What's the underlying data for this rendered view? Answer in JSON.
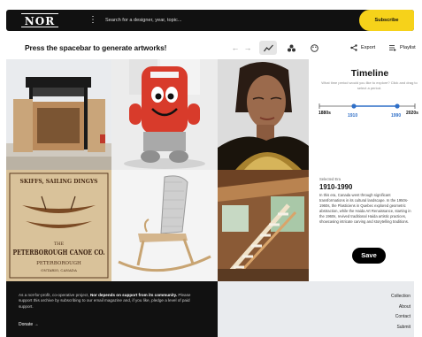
{
  "header": {
    "logo": "NOR",
    "search_placeholder": "Search for a designer, year, topic...",
    "subscribe_label": "Subscribe"
  },
  "toolbar": {
    "prompt": "Press the spacebar to generate artworks!",
    "export_label": "Export",
    "playlist_label": "Playlist"
  },
  "timeline": {
    "title": "Timeline",
    "subtitle": "What time period would you like to explore? Click and drag to select a period.",
    "start_year": "1880s",
    "end_year": "2020s",
    "selected_start": "1910",
    "selected_end": "1990",
    "accent_color": "#2f6fc7"
  },
  "selected": {
    "label": "Selected Era",
    "range": "1910-1990",
    "description": "In this era, Canada went through significant transformations in its cultural landscape. In the 1950s-1960s, the Plasticiens in Quebec explored geometric abstraction, while the Haida Art Renaissance, starting in the 1960s, revived traditional Haida artistic practices, showcasing intricate carving and storytelling traditions."
  },
  "save_label": "Save",
  "footer": {
    "intro": "As a not-for-profit, co-operative project, ",
    "intro_bold": "Nor depends on support from its community.",
    "rest": " Please support this archive by subscribing to our email magazine and, if you like, pledge a level of paid support.",
    "donate_label": "Donate →",
    "links": [
      "Collection",
      "About",
      "Contact",
      "Submit"
    ]
  },
  "canoe_sign": {
    "line1": "SKIFFS, SAILING DINGYS",
    "line2": "THE",
    "line3": "PETERBOROUGH CANOE CO.",
    "line4": "PETERBOROUGH",
    "line5": "ONTARIO, CANADA"
  }
}
